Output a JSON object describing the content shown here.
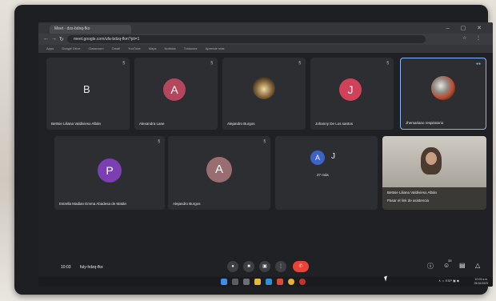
{
  "browser": {
    "tab_title": "Meet - dzs-bdnq-fko",
    "url": "meet.google.com/ufa-bdzq-fkm?pli=1",
    "window_controls": "–  ▢  ✕",
    "toolbar_icons": "☆ ⋮",
    "bookmarks": [
      "Apps",
      "Google Drive",
      "Classroom",
      "Gmail",
      "YouTube",
      "Maps",
      "Noticias",
      "Traductor",
      "Aprende más"
    ]
  },
  "tiles": [
    {
      "name": "Bettsie Liliana Valdivieso Albán",
      "letter": "B",
      "mic": "§",
      "avatar_color": ""
    },
    {
      "name": "Alexandra Lane",
      "letter": "A",
      "mic": "§",
      "avatar_color": "#b5475d"
    },
    {
      "name": "Alejandro Burgos",
      "letter": "",
      "mic": "§",
      "avatar_color": ""
    },
    {
      "name": "Johanny De Los santos",
      "letter": "J",
      "mic": "§",
      "avatar_color": "#d0425a"
    },
    {
      "name": "Jhemariano respiratorio",
      "letter": "",
      "mic": "§",
      "avatar_color": ""
    },
    {
      "name": "Estrella Madian Emma Abadesa de Matán",
      "letter": "P",
      "mic": "§",
      "avatar_color": "#7b3fb3"
    },
    {
      "name": "Alejandro Burgos",
      "letter": "A",
      "mic": "§",
      "avatar_color": "#9a6d73"
    },
    {
      "name": "27 más",
      "letter": "A",
      "letter2": "J",
      "mic": "",
      "avatar_color": "#3d63c9"
    },
    {
      "name": "Bettsie Liliana Valdivieso Albán",
      "subtitle": "Pasar el link de asistencia",
      "letter": "",
      "mic": "",
      "avatar_color": ""
    }
  ],
  "bottom_bar": {
    "time": "10:03",
    "code": "fuly-hdzq-fko",
    "participant_count": "33",
    "controls": {
      "mic": "●",
      "camera": "■",
      "present": "▣",
      "more": "⋮",
      "end": "✆",
      "info": "ⓘ",
      "people": "☺",
      "chat": "▤",
      "activities": "△"
    }
  },
  "taskbar": {
    "tray": "∧  ☼  ESP  ▣ ◆",
    "time": "10:03 a.m.",
    "date": "25/10/2023"
  }
}
